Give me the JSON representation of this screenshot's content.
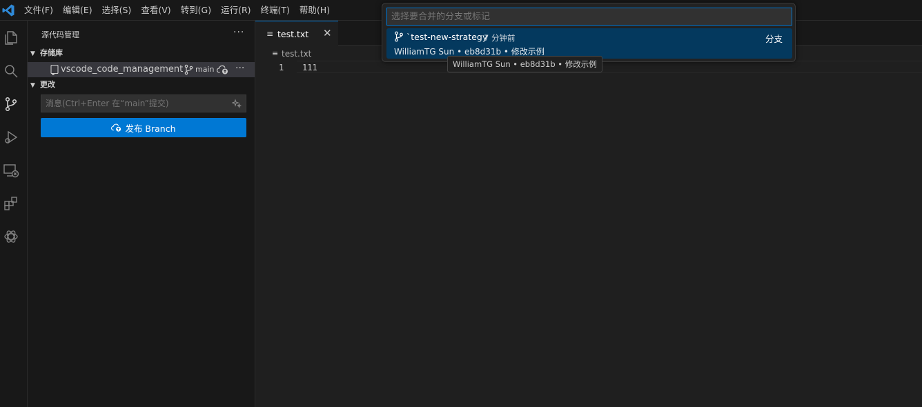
{
  "menu": [
    "文件(F)",
    "编辑(E)",
    "选择(S)",
    "查看(V)",
    "转到(G)",
    "运行(R)",
    "终端(T)",
    "帮助(H)"
  ],
  "sidebar": {
    "title": "源代码管理",
    "more": "···",
    "repos_header": "存储库",
    "repo": {
      "name": "vscode_code_management",
      "branch": "main",
      "more": "···"
    },
    "changes_header": "更改",
    "commit_placeholder": "消息(Ctrl+Enter 在“main”提交)",
    "publish_label": "发布 Branch"
  },
  "editor": {
    "tab_label": "test.txt",
    "close_glyph": "✕",
    "breadcrumb": "test.txt",
    "lines": [
      {
        "number": "1",
        "text": "111"
      }
    ]
  },
  "quickpick": {
    "placeholder": "选择要合并的分支或标记",
    "item": {
      "name": "`test-new-strategy",
      "time": "7 分钟前",
      "kind": "分支",
      "detail": "WilliamTG Sun • eb8d31b • 修改示例"
    }
  },
  "tooltip": "WilliamTG Sun • eb8d31b • 修改示例",
  "colors": {
    "accent": "#0078d4",
    "selection": "#04395e",
    "background": "#1f1f1f",
    "sidebar": "#181818"
  },
  "icons": [
    "vscode-logo-icon",
    "explorer-icon",
    "search-icon",
    "source-control-icon",
    "run-debug-icon",
    "remote-explorer-icon",
    "extensions-icon",
    "chatgpt-icon",
    "repo-icon",
    "branch-icon",
    "cloud-upload-icon",
    "sparkle-icon",
    "file-lines-icon",
    "close-icon"
  ]
}
